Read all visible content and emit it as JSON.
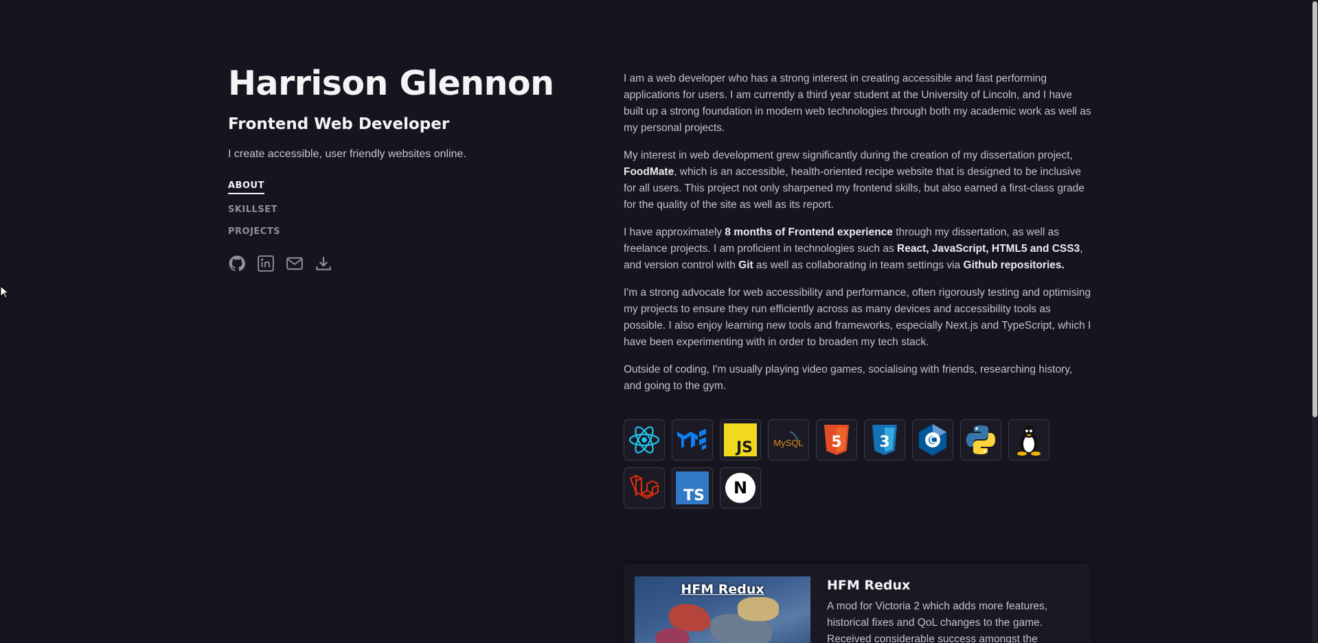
{
  "profile": {
    "name": "Harrison Glennon",
    "role": "Frontend Web Developer",
    "tagline": "I create accessible, user friendly websites online."
  },
  "nav": {
    "about": "ABOUT",
    "skillset": "SKILLSET",
    "projects": "PROJECTS",
    "active": "about"
  },
  "socials": [
    "github-icon",
    "linkedin-icon",
    "email-icon",
    "download-icon"
  ],
  "about": {
    "p1": "I am a web developer who has a strong interest in creating accessible and fast performing applications for users. I am currently a third year student at the University of Lincoln, and I have built up a strong foundation in modern web technologies through both my academic work as well as my personal projects.",
    "p2_a": "My interest in web development grew significantly during the creation of my dissertation project, ",
    "p2_b": "FoodMate",
    "p2_c": ", which is an accessible, health-oriented recipe website that is designed to be inclusive for all users. This project not only sharpened my frontend skills, but also earned a first-class grade for the quality of the site as well as its report.",
    "p3_a": "I have approximately ",
    "p3_b": "8 months of Frontend experience",
    "p3_c": " through my dissertation, as well as freelance projects. I am proficient in technologies such as ",
    "p3_d": "React, JavaScript, HTML5 and CSS3",
    "p3_e": ", and version control with ",
    "p3_f": "Git",
    "p3_g": " as well as collaborating in team settings via ",
    "p3_h": "Github repositories.",
    "p4": "I'm a strong advocate for web accessibility and performance, often rigorously testing and optimising my projects to ensure they run efficiently across as many devices and accessibility tools as possible. I also enjoy learning new tools and frameworks, especially Next.js and TypeScript, which I have been experimenting with in order to broaden my tech stack.",
    "p5": "Outside of coding, I'm usually playing video games, socialising with friends, researching history, and going to the gym."
  },
  "skills": [
    "react-icon",
    "mui-icon",
    "javascript-icon",
    "mysql-icon",
    "html5-icon",
    "css3-icon",
    "cpp-icon",
    "python-icon",
    "linux-icon",
    "laravel-icon",
    "typescript-icon",
    "nextjs-icon"
  ],
  "skill_labels": {
    "js": "JS",
    "mysql": "MySQL",
    "ts": "TS",
    "html": "5",
    "css": "3",
    "cpp": "C",
    "next": "N"
  },
  "project": {
    "thumb_title": "HFM Redux",
    "title": "HFM Redux",
    "description": "A mod for Victoria 2 which adds more features, historical fixes and QoL changes to the game. Received considerable success amongst the"
  },
  "colors": {
    "background": "#16151f",
    "heading": "#f4f4f6",
    "body_text": "#c2c3ca",
    "muted": "#8e8f99"
  }
}
